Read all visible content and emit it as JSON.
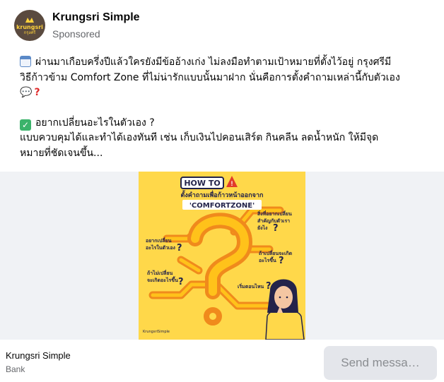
{
  "header": {
    "page_name": "Krungsri Simple",
    "sponsored": "Sponsored",
    "avatar": {
      "logo_en": "krungsri",
      "logo_th": "กรุงศรี"
    }
  },
  "post": {
    "paragraph1_line1": "ผ่านมาเกือบครึ่งปีแล้วใครยังมีข้ออ้างเก่ง ไม่ลงมือทำตามเป้าหมายที่ตั้งไว้อยู่ กรุงศรีมี",
    "paragraph1_line2": "วิธีก้าวข้าม Comfort Zone ที่ไม่น่ารักแบบนั้นมาฝาก นั่นคือการตั้งคำถามเหล่านี้กับตัวเอง",
    "paragraph2_line1": "อยากเปลี่ยนอะไรในตัวเอง ?",
    "paragraph2_line2": "แบบควบคุมได้และทำได้เองทันที เช่น เก็บเงินไปคอนเสิร์ต กินคลีน ลดน้ำหนัก ให้มีจุด",
    "paragraph2_line3": "หมายที่ชัดเจนขึ้น...",
    "icons": [
      "calendar-icon",
      "speech-bubble-icon",
      "question-mark-icon",
      "check-box-icon"
    ]
  },
  "poster": {
    "how_to": "HOW TO",
    "subtitle": "ตั้งคำถามเพื่อก้าวหน้าออกจาก",
    "comfortzone": "'COMFORTZONE'",
    "q1": "อยากเปลี่ยน",
    "q1b": "อะไรในตัวเอง",
    "q2": "สิ่งที่อยากเปลี่ยน",
    "q2b": "สำคัญกับตัวเรา",
    "q2c": "ยังไง",
    "q3": "ถ้าเปลี่ยนจะเกิด",
    "q3b": "อะไรขึ้น",
    "q4": "ถ้าไม่เปลี่ยน",
    "q4b": "จะเกิดอะไรขึ้น",
    "q5": "เริ่มตอนไหน",
    "qmark": "?",
    "brand": "KrungsriSimple",
    "colors": {
      "background": "#ffd84a",
      "path_outer": "#f08a1c",
      "path_inner": "#ffc21a",
      "navy": "#23234a"
    }
  },
  "footer": {
    "name": "Krungsri Simple",
    "category": "Bank",
    "send_button": "Send messa…"
  }
}
